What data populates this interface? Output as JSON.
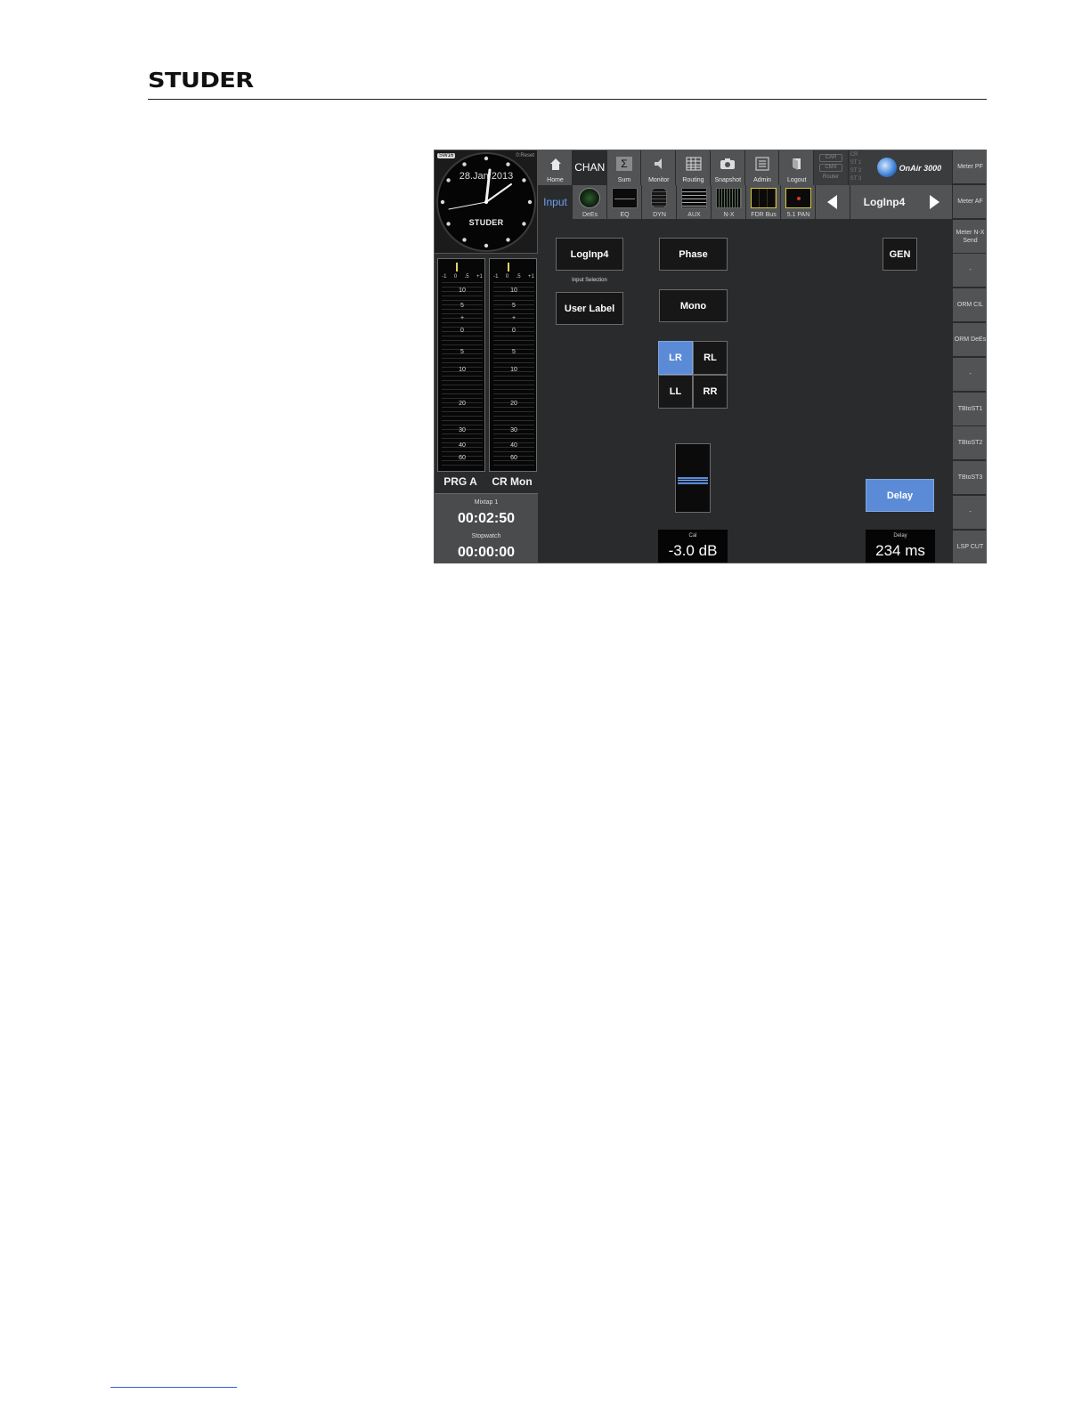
{
  "document": {
    "brand": "STUDER"
  },
  "clock": {
    "badge": "SW16",
    "offset": "0:Reset",
    "date": "28.Jan 2013",
    "brand": "STUDER"
  },
  "meters": [
    {
      "name": "PRG A",
      "top_scale": [
        "-1",
        "0",
        ".5",
        "+1"
      ],
      "scale": [
        "10",
        "5",
        "+",
        "0",
        "5",
        "10",
        "20",
        "30",
        "40",
        "60"
      ]
    },
    {
      "name": "CR Mon",
      "top_scale": [
        "-1",
        "0",
        ".5",
        "+1"
      ],
      "scale": [
        "10",
        "5",
        "+",
        "0",
        "5",
        "10",
        "20",
        "30",
        "40",
        "60"
      ]
    }
  ],
  "timers": {
    "timer1_label": "Mixtap 1",
    "timer1_value": "00:02:50",
    "timer2_label": "Stopwatch",
    "timer2_value": "00:00:00"
  },
  "toolbar": {
    "home": "Home",
    "chan": "CHAN",
    "sum": "Sum",
    "monitor": "Monitor",
    "routing": "Routing",
    "snapshot": "Snapshot",
    "admin": "Admin",
    "logout": "Logout",
    "status_car": "CAR",
    "status_cmx": "CMX",
    "status_router": "Router",
    "status_cr": "CR",
    "status_st1": "ST 1",
    "status_st2": "ST 2",
    "status_st3": "ST 3",
    "product": "OnAir 3000"
  },
  "subbar": {
    "input": "Input",
    "dees": "DeEs",
    "eq": "EQ",
    "dyn": "DYN",
    "aux": "AUX",
    "nx": "N-X",
    "fdr_bus": "FDR Bus",
    "pan": "5.1 PAN",
    "channel_name": "LogInp4"
  },
  "side_buttons": [
    "Meter PF",
    "Meter AF",
    "Meter N-X Send",
    "-",
    "ORM CIL",
    "ORM DeEs",
    "-",
    "TBtoST1",
    "TBtoST2",
    "TBtoST3",
    "-",
    "LSP CUT"
  ],
  "main": {
    "source_button": "LogInp4",
    "input_selection_label": "Input Selection",
    "user_label_button": "User Label",
    "phase_button": "Phase",
    "mono_button": "Mono",
    "routing_lr": "LR",
    "routing_rl": "RL",
    "routing_ll": "LL",
    "routing_rr": "RR",
    "gen_button": "GEN",
    "delay_button": "Delay",
    "cal_label": "Cal",
    "cal_value": "-3.0 dB",
    "delay_label": "Delay",
    "delay_value": "234 ms"
  },
  "colors": {
    "accent_blue": "#5b8bd6",
    "panel_bg": "#2a2b2d",
    "toolbar_bg": "#525355"
  },
  "icons": {
    "home": "home-icon",
    "sum": "sigma-icon",
    "monitor": "speaker-icon",
    "routing": "grid-icon",
    "snapshot": "camera-icon",
    "admin": "list-icon",
    "logout": "door-icon"
  }
}
